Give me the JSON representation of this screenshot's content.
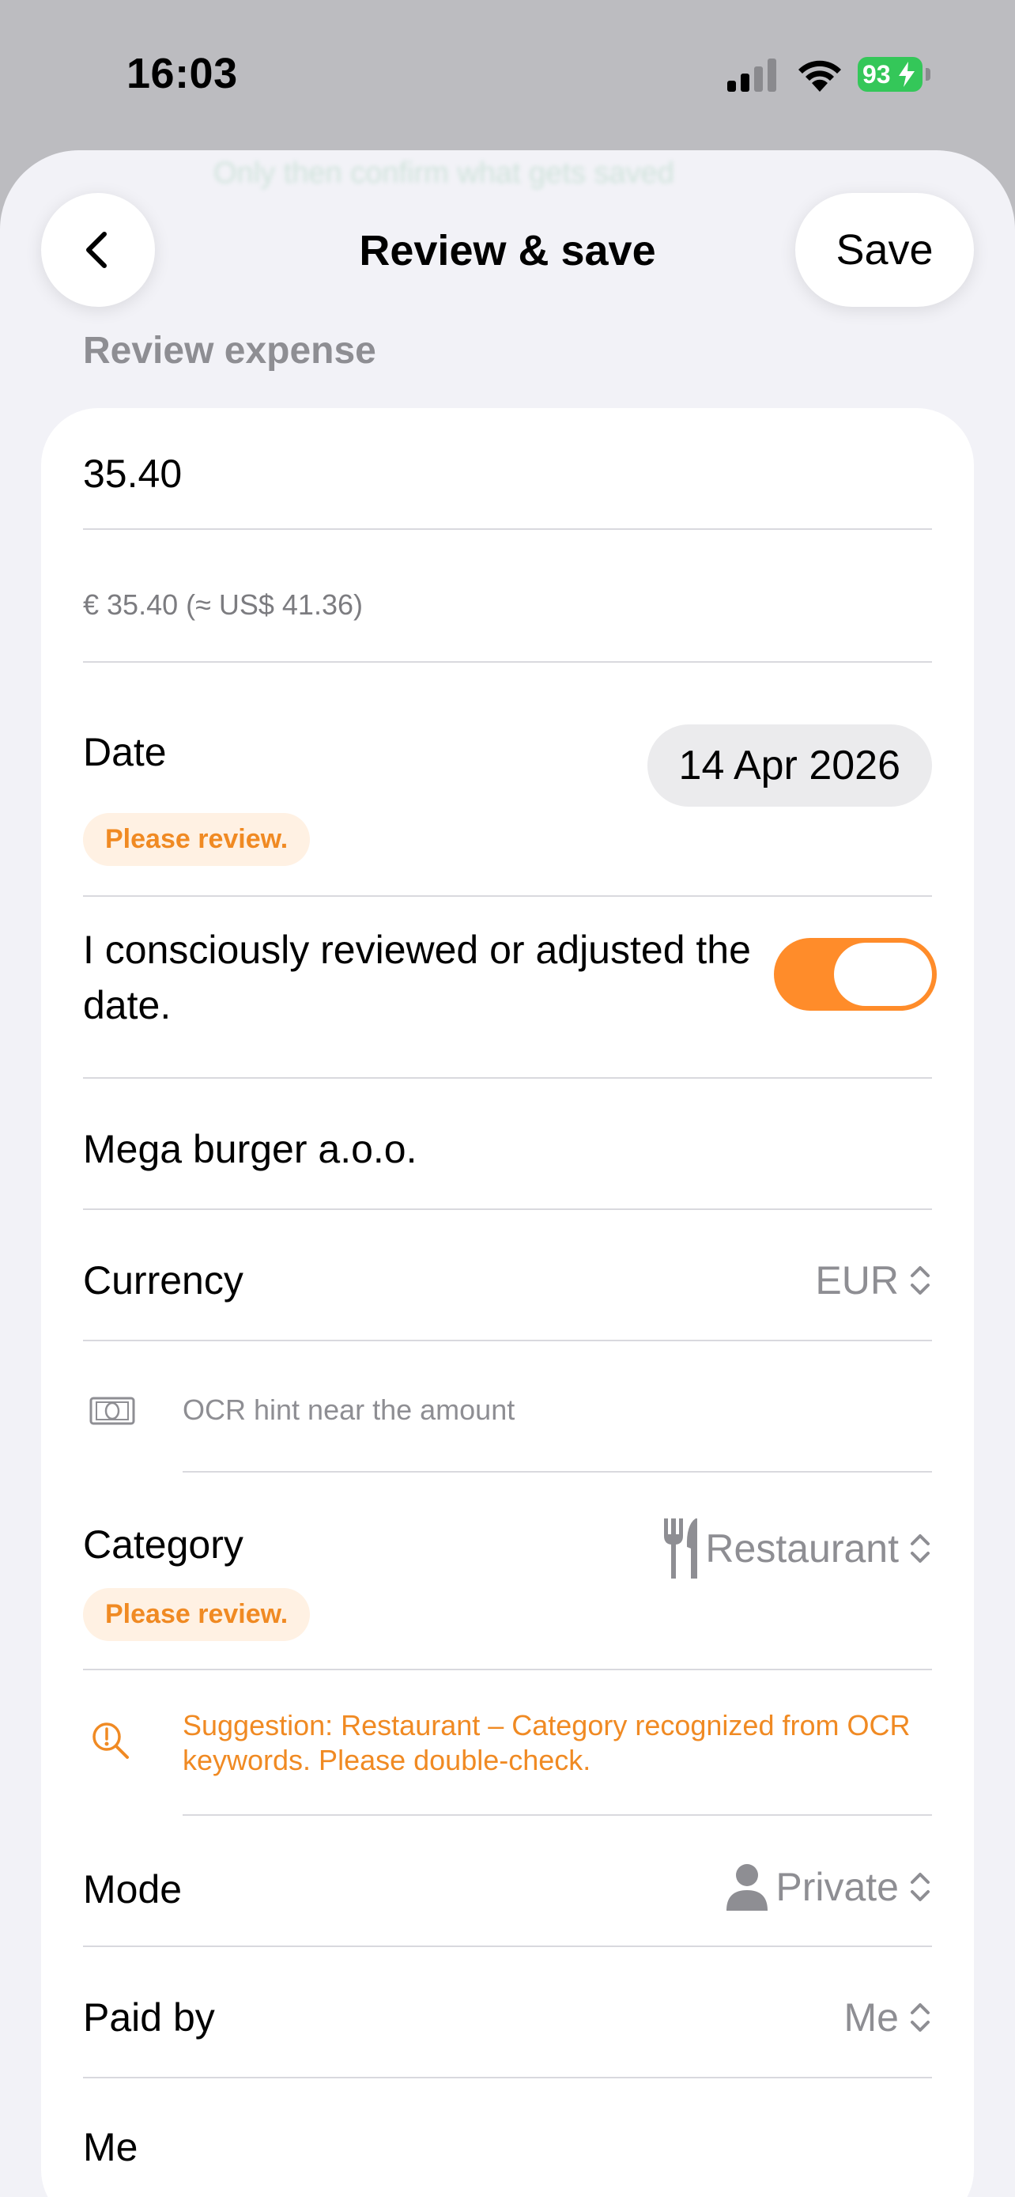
{
  "status": {
    "time": "16:03",
    "battery": "93"
  },
  "nav": {
    "title": "Review & save",
    "save_label": "Save",
    "ghost_hint": "Only then confirm what gets saved"
  },
  "section": {
    "header": "Review expense"
  },
  "form": {
    "amount": "35.40",
    "amount_converted": "€ 35.40 (≈ US$ 41.36)",
    "date": {
      "label": "Date",
      "value": "14 Apr 2026",
      "badge": "Please review."
    },
    "date_confirm": {
      "label": "I consciously reviewed or adjusted the date.",
      "on": true
    },
    "merchant": "Mega burger a.o.o.",
    "currency": {
      "label": "Currency",
      "value": "EUR"
    },
    "ocr_hint": {
      "icon": "banknote-icon",
      "text": "OCR hint near the amount"
    },
    "category": {
      "label": "Category",
      "icon": "fork-knife-icon",
      "value": "Restaurant",
      "badge": "Please review."
    },
    "suggestion": {
      "icon": "magnifier-alert-icon",
      "text": "Suggestion: Restaurant – Category recognized from OCR keywords. Please double-check."
    },
    "mode": {
      "label": "Mode",
      "icon": "person-icon",
      "value": "Private"
    },
    "paid_by": {
      "label": "Paid by",
      "value": "Me"
    },
    "payer_name": "Me"
  },
  "colors": {
    "accent": "#ff8c2a",
    "badge_bg": "#fff1e3",
    "battery": "#34c759"
  }
}
